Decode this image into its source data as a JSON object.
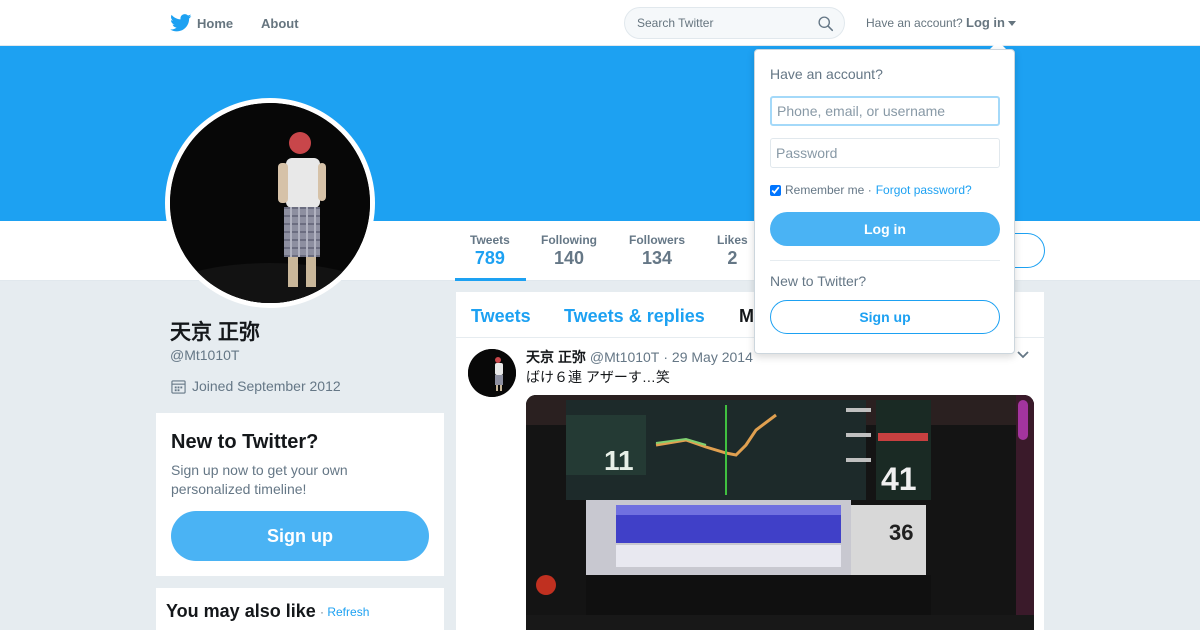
{
  "colors": {
    "brand": "#1da1f2",
    "button": "#4ab3f4",
    "background": "#e6ecf0"
  },
  "topnav": {
    "logo_icon": "twitter-bird-icon",
    "home_label": "Home",
    "about_label": "About",
    "search_placeholder": "Search Twitter",
    "have_account": "Have an account?",
    "login_label": "Log in"
  },
  "profile": {
    "name": "天京 正弥",
    "handle": "@Mt1010T",
    "joined": "Joined September 2012"
  },
  "stats": [
    {
      "label": "Tweets",
      "value": "789"
    },
    {
      "label": "Following",
      "value": "140"
    },
    {
      "label": "Followers",
      "value": "134"
    },
    {
      "label": "Likes",
      "value": "2"
    }
  ],
  "signup_card": {
    "title": "New to Twitter?",
    "description": "Sign up now to get your own personalized timeline!",
    "button": "Sign up"
  },
  "ymal": {
    "title": "You may also like",
    "separator": "·",
    "refresh": "Refresh"
  },
  "timeline": {
    "tabs": [
      "Tweets",
      "Tweets & replies",
      "M"
    ],
    "tweet": {
      "name": "天京 正弥",
      "handle": "@Mt1010T",
      "date": "· 29 May 2014",
      "text": "ばけ６連 アザーす…笑"
    }
  },
  "dropdown": {
    "title": "Have an account?",
    "username_placeholder": "Phone, email, or username",
    "password_placeholder": "Password",
    "remember": "Remember me ·",
    "forgot": "Forgot password?",
    "login_button": "Log in",
    "new_to_twitter": "New to Twitter?",
    "signup_button": "Sign up"
  }
}
